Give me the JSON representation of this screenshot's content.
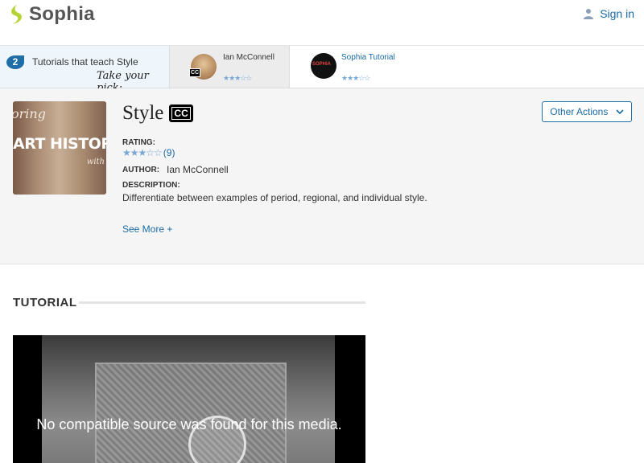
{
  "header": {
    "brand": "Sophia",
    "signin_label": "Sign in"
  },
  "strip": {
    "count": "2",
    "count_label": "Tutorials that teach Style",
    "pick_label": "Take your pick:",
    "cards": [
      {
        "name": "Ian McConnell",
        "stars": "★★★☆☆",
        "cc": "CC"
      },
      {
        "name": "Sophia Tutorial",
        "stars": "★★★☆☆",
        "thumb_text": "SOPHIA"
      }
    ]
  },
  "tutorial": {
    "art_lines": [
      "oring",
      "ART HISTORY",
      "with"
    ],
    "title": "Style",
    "cc_label": "CC",
    "other_actions_label": "Other Actions",
    "rating_label": "RATING:",
    "rating_stars": "★★★☆☆",
    "rating_count": "(9)",
    "author_label": "AUTHOR:",
    "author": "Ian McConnell",
    "description_label": "DESCRIPTION:",
    "description": "Differentiate between examples of period, regional, and individual style.",
    "see_more": "See More +"
  },
  "section": {
    "heading": "TUTORIAL"
  },
  "video": {
    "message": "No compatible source was found for this media."
  },
  "colors": {
    "accent": "#1a6aa5",
    "logo_green": "#b5d334"
  }
}
